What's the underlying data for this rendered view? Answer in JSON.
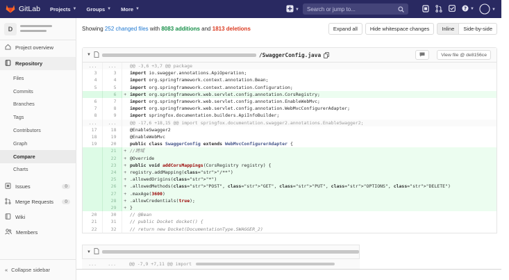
{
  "topbar": {
    "brand": "GitLab",
    "nav": [
      {
        "label": "Projects"
      },
      {
        "label": "Groups"
      },
      {
        "label": "More"
      }
    ],
    "search_placeholder": "Search or jump to..."
  },
  "sidebar": {
    "project_initial": "D",
    "overview": "Project overview",
    "repository": "Repository",
    "repo_items": [
      "Files",
      "Commits",
      "Branches",
      "Tags",
      "Contributors",
      "Graph",
      "Compare",
      "Charts"
    ],
    "issues": "Issues",
    "issues_count": "0",
    "merge_requests": "Merge Requests",
    "merge_requests_count": "0",
    "wiki": "Wiki",
    "members": "Members",
    "collapse": "Collapse sidebar"
  },
  "stats": {
    "prefix": "Showing",
    "changed": "252 changed files",
    "with": "with",
    "additions": "8083 additions",
    "and": "and",
    "deletions": "1813 deletions"
  },
  "toolbar": {
    "expand_all": "Expand all",
    "hide_whitespace": "Hide whitespace changes",
    "inline": "Inline",
    "side_by_side": "Side-by-side"
  },
  "file": {
    "name": "/SwaggerConfig.java",
    "view_file": "View file @ de8156ce",
    "lines": [
      {
        "type": "match",
        "old": "...",
        "new": "...",
        "sign": "",
        "code": "@@ -3,6 +3,7 @@ package"
      },
      {
        "type": "ctx",
        "old": "3",
        "new": "3",
        "sign": "",
        "code": "import io.swagger.annotations.ApiOperation;"
      },
      {
        "type": "ctx",
        "old": "4",
        "new": "4",
        "sign": "",
        "code": "import org.springframework.context.annotation.Bean;"
      },
      {
        "type": "ctx",
        "old": "5",
        "new": "5",
        "sign": "",
        "code": "import org.springframework.context.annotation.Configuration;"
      },
      {
        "type": "add",
        "old": "",
        "new": "6",
        "sign": "+",
        "code": "import org.springframework.web.servlet.config.annotation.CorsRegistry;"
      },
      {
        "type": "ctx",
        "old": "6",
        "new": "7",
        "sign": "",
        "code": "import org.springframework.web.servlet.config.annotation.EnableWebMvc;"
      },
      {
        "type": "ctx",
        "old": "7",
        "new": "8",
        "sign": "",
        "code": "import org.springframework.web.servlet.config.annotation.WebMvcConfigurerAdapter;"
      },
      {
        "type": "ctx",
        "old": "8",
        "new": "9",
        "sign": "",
        "code": "import springfox.documentation.builders.ApiInfoBuilder;"
      },
      {
        "type": "match",
        "old": "...",
        "new": "...",
        "sign": "",
        "code": "@@ -17,6 +18,15 @@ import springfox.documentation.swagger2.annotations.EnableSwagger2;"
      },
      {
        "type": "ctx",
        "old": "17",
        "new": "18",
        "sign": "",
        "code": "@EnableSwagger2"
      },
      {
        "type": "ctx",
        "old": "18",
        "new": "19",
        "sign": "",
        "code": "@EnableWebMvc"
      },
      {
        "type": "ctx",
        "old": "19",
        "new": "20",
        "sign": "",
        "code": "public class SwaggerConfig extends WebMvcConfigurerAdapter {"
      },
      {
        "type": "add",
        "old": "",
        "new": "21",
        "sign": "+",
        "code": "    //跨域"
      },
      {
        "type": "add",
        "old": "",
        "new": "22",
        "sign": "+",
        "code": "    @Override"
      },
      {
        "type": "add",
        "old": "",
        "new": "23",
        "sign": "+",
        "code": "    public void addCorsMappings(CorsRegistry registry) {"
      },
      {
        "type": "add",
        "old": "",
        "new": "24",
        "sign": "+",
        "code": "        registry.addMapping(\"/**\")"
      },
      {
        "type": "add",
        "old": "",
        "new": "25",
        "sign": "+",
        "code": "                .allowedOrigins(\"*\")"
      },
      {
        "type": "add",
        "old": "",
        "new": "26",
        "sign": "+",
        "code": "                .allowedMethods(\"POST\", \"GET\", \"PUT\", \"OPTIONS\", \"DELETE\")"
      },
      {
        "type": "add",
        "old": "",
        "new": "27",
        "sign": "+",
        "code": "                .maxAge(3600)"
      },
      {
        "type": "add",
        "old": "",
        "new": "28",
        "sign": "+",
        "code": "                .allowCredentials(true);"
      },
      {
        "type": "add",
        "old": "",
        "new": "29",
        "sign": "+",
        "code": "    }"
      },
      {
        "type": "ctx",
        "old": "20",
        "new": "30",
        "sign": "",
        "code": "//    @Bean"
      },
      {
        "type": "ctx",
        "old": "21",
        "new": "31",
        "sign": "",
        "code": "//    public Docket docket() {"
      },
      {
        "type": "ctx",
        "old": "22",
        "new": "32",
        "sign": "",
        "code": "//        return new Docket(DocumentationType.SWAGGER_2)"
      }
    ]
  },
  "file2": {
    "match_old": "...",
    "match_new": "...",
    "match_code": "@@ -7,9 +7,11 @@ import"
  },
  "colors": {
    "topbar": "#292961",
    "addition": "#168f48",
    "deletion": "#db3b21",
    "link": "#1f78d1",
    "added_line_bg": "#ecfdf0"
  }
}
